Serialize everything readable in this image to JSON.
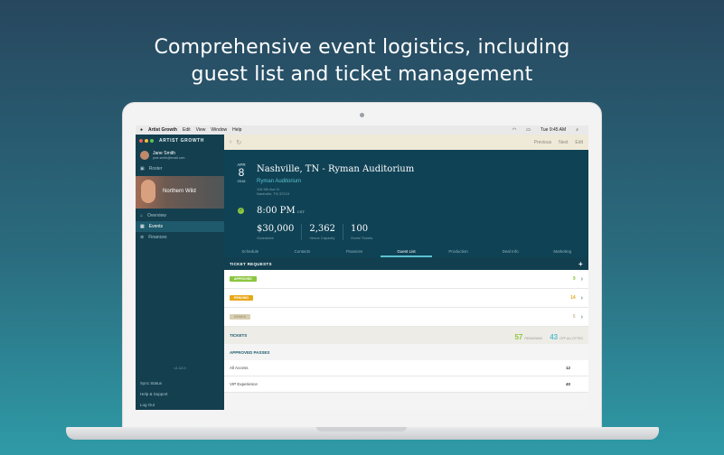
{
  "headline": {
    "line1": "Comprehensive event logistics, including",
    "line2": "guest list and ticket management"
  },
  "menubar": {
    "items": [
      "Artist Growth",
      "Edit",
      "View",
      "Window",
      "Help"
    ],
    "clock": "Tue 9:45 AM"
  },
  "sidebar": {
    "brand": "ARTIST GROWTH",
    "user_name": "Jane Smith",
    "user_email": "jane.smith@email.com",
    "roster_label": "Roster",
    "artist_name": "Northern Wild",
    "items": [
      {
        "label": "Overview",
        "icon": "home-icon"
      },
      {
        "label": "Events",
        "icon": "calendar-icon"
      },
      {
        "label": "Finances",
        "icon": "finance-icon"
      }
    ],
    "version": "v1.12.0",
    "footer": [
      "Sync Status",
      "Help & Support",
      "Log Out"
    ]
  },
  "topnav": {
    "previous": "Previous",
    "next": "Next",
    "edit": "Edit"
  },
  "event": {
    "month": "APR",
    "day": "8",
    "year": "2016",
    "title": "Nashville, TN - Ryman Auditorium",
    "venue": "Ryman Auditorium",
    "address1": "116 5th Ave N",
    "address2": "Nashville, TN 37219",
    "time": "8:00 PM",
    "timezone": "CST",
    "stats": [
      {
        "value": "$30,000",
        "label": "Guarantee"
      },
      {
        "value": "2,362",
        "label": "Venue Capacity"
      },
      {
        "value": "100",
        "label": "Guest Tickets"
      }
    ]
  },
  "tabs": [
    "Schedule",
    "Contacts",
    "Finances",
    "Guest List",
    "Production",
    "Deal Info",
    "Marketing"
  ],
  "ticket_requests": {
    "title": "TICKET REQUESTS",
    "rows": [
      {
        "badge": "APPROVED",
        "count": "9",
        "color": "#8cc63f"
      },
      {
        "badge": "PENDING",
        "count": "14",
        "color": "#e8a818"
      },
      {
        "badge": "DENIED",
        "count": "5",
        "color": "#d9cfb0"
      }
    ]
  },
  "tickets": {
    "label": "TICKETS",
    "remaining_value": "57",
    "remaining_label": "REMAINING",
    "allotted_value": "43",
    "allotted_label": "OFF ALLOTTED"
  },
  "approved_passes": {
    "title": "APPROVED PASSES",
    "rows": [
      {
        "name": "All Access",
        "count": "12"
      },
      {
        "name": "VIP Experience",
        "count": "40"
      }
    ]
  },
  "colors": {
    "accent": "#5bc1d0",
    "header_bg": "#0f4255",
    "green": "#8cc63f",
    "orange": "#e8a818"
  }
}
